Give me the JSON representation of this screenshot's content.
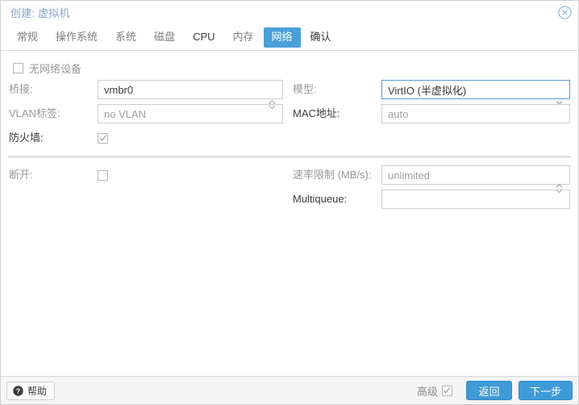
{
  "window": {
    "title": "创建: 虚拟机",
    "close_icon": "close-circle-icon"
  },
  "tabs": [
    {
      "label": "常规",
      "active": false,
      "emphasis": "muted"
    },
    {
      "label": "操作系统",
      "active": false,
      "emphasis": "muted"
    },
    {
      "label": "系统",
      "active": false,
      "emphasis": "muted"
    },
    {
      "label": "磁盘",
      "active": false,
      "emphasis": "muted"
    },
    {
      "label": "CPU",
      "active": false,
      "emphasis": "dark"
    },
    {
      "label": "内存",
      "active": false,
      "emphasis": "muted"
    },
    {
      "label": "网络",
      "active": true,
      "emphasis": "active"
    },
    {
      "label": "确认",
      "active": false,
      "emphasis": "dark"
    }
  ],
  "form": {
    "no_network_device": {
      "label": "无网络设备",
      "checked": false
    },
    "bridge": {
      "label": "桥接:",
      "value": "vmbr0",
      "is_placeholder": false,
      "control": "combobox",
      "icon": "chevron-down-icon"
    },
    "vlan_tag": {
      "label": "VLAN标签:",
      "value": "no VLAN",
      "is_placeholder": true,
      "control": "spinner",
      "icon": "spinner-arrows-icon"
    },
    "firewall": {
      "label": "防火墙:",
      "checked": true
    },
    "model": {
      "label": "模型:",
      "value": "VirtIO (半虚拟化)",
      "is_placeholder": false,
      "focused": true,
      "control": "combobox",
      "icon": "chevron-down-icon"
    },
    "mac_address": {
      "label": "MAC地址:",
      "value": "auto",
      "is_placeholder": true,
      "control": "text"
    },
    "disconnect": {
      "label": "断开:",
      "checked": false
    },
    "rate_limit": {
      "label": "速率限制 (MB/s):",
      "value": "unlimited",
      "is_placeholder": true,
      "control": "spinner",
      "icon": "spinner-arrows-icon"
    },
    "multiqueue": {
      "label": "Multiqueue:",
      "value": "",
      "is_placeholder": true,
      "control": "spinner",
      "icon": "spinner-arrows-icon"
    }
  },
  "footer": {
    "help_label": "帮助",
    "help_icon": "question-circle-icon",
    "advanced_label": "高级",
    "advanced_checked": true,
    "back_label": "返回",
    "next_label": "下一步"
  },
  "colors": {
    "accent": "#3f9ad8",
    "tab_active_bg": "#49a0d8",
    "title_text": "#8aa4c8",
    "label_muted": "#999999",
    "label_dark": "#3c3c3c",
    "field_border": "#cfcfcf",
    "field_focus_border": "#5b9bd5",
    "footer_bg": "#f5f5f5",
    "placeholder": "#a0a0a0"
  }
}
